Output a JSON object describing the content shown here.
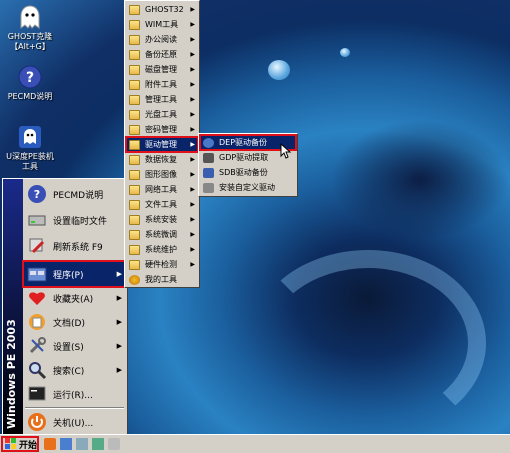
{
  "desktop": {
    "icons": [
      {
        "label": "GHOST克隆\n【Alt+G】",
        "icon": "ghost-icon"
      },
      {
        "label": "PECMD说明",
        "icon": "help-icon"
      },
      {
        "label": "U深度PE装机\n工具",
        "icon": "ghost-icon"
      }
    ]
  },
  "start_menu": {
    "sidebar_text": "Windows PE 2003",
    "items": [
      {
        "label": "PECMD说明",
        "icon": "help-icon"
      },
      {
        "label": "设置临时文件",
        "icon": "drive-icon"
      },
      {
        "label": "刷新系统 F9",
        "icon": "refresh-icon"
      },
      {
        "label": "程序(P)",
        "icon": "programs-icon"
      },
      {
        "label": "收藏夹(A)",
        "icon": "favorites-icon"
      },
      {
        "label": "文档(D)",
        "icon": "documents-icon"
      },
      {
        "label": "设置(S)",
        "icon": "settings-icon"
      },
      {
        "label": "搜索(C)",
        "icon": "search-icon"
      },
      {
        "label": "运行(R)...",
        "icon": "run-icon"
      },
      {
        "label": "关机(U)...",
        "icon": "shutdown-icon"
      }
    ]
  },
  "programs_menu": {
    "items": [
      "GHOST32",
      "WIM工具",
      "办公阅读",
      "备份还原",
      "磁盘管理",
      "附件工具",
      "管理工具",
      "光盘工具",
      "密码管理",
      "驱动管理",
      "数据恢复",
      "图形图像",
      "网络工具",
      "文件工具",
      "系统安装",
      "系统微调",
      "系统维护",
      "硬件检测",
      "我的工具"
    ],
    "highlighted": "驱动管理"
  },
  "driver_menu": {
    "items": [
      "DEP驱动备份",
      "GDP驱动提取",
      "SDB驱动备份",
      "安装自定义驱动"
    ],
    "highlighted": "DEP驱动备份"
  },
  "taskbar": {
    "start_label": "开始"
  },
  "colors": {
    "highlight": "#0a246a",
    "red_outline": "#e0101a",
    "menu_bg": "#d4d0c8"
  }
}
